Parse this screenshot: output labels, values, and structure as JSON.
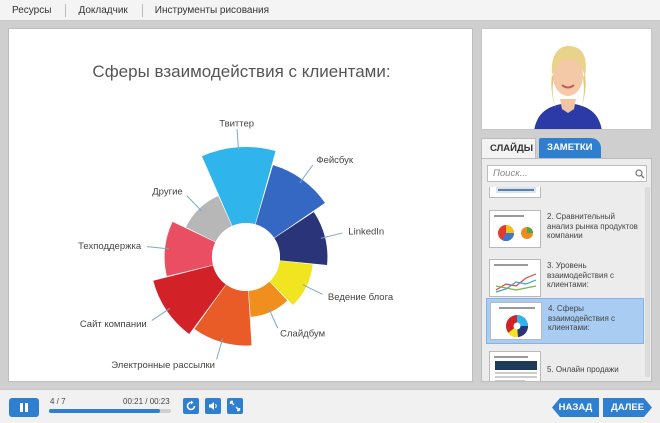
{
  "topbar": {
    "items": [
      "Ресурсы",
      "Докладчик",
      "Инструменты рисования"
    ]
  },
  "slide": {
    "title": "Сферы взаимодействия с клиентами:"
  },
  "chart_data": {
    "type": "pie",
    "title": "Сферы взаимодействия с клиентами:",
    "categories": [
      "Твиттер",
      "Фейсбук",
      "LinkedIn",
      "Ведение блога",
      "Слайдбум",
      "Электронные рассылки",
      "Сайт компании",
      "Техподдержка",
      "Другие"
    ],
    "values": [
      10,
      8,
      6,
      4,
      3,
      7,
      8,
      6,
      4
    ],
    "colors": [
      "#2fb5ec",
      "#3568c2",
      "#2a3478",
      "#f1e420",
      "#f18f1e",
      "#e95b27",
      "#d32128",
      "#ea4e63",
      "#b7b7b7"
    ]
  },
  "sidebar": {
    "tab_slides": "СЛАЙДЫ",
    "tab_notes": "ЗАМЕТКИ",
    "search_placeholder": "Поиск...",
    "items": [
      {
        "label": ""
      },
      {
        "label": "2. Сравнительный анализ рынка продуктов компании"
      },
      {
        "label": "3. Уровень взаимодействия с клиентами:"
      },
      {
        "label": "4. Сферы взаимодействия с клиентами:"
      },
      {
        "label": "5. Онлайн продажи"
      }
    ],
    "active_index": 3
  },
  "player": {
    "counter": "4 / 7",
    "time": "00:21 / 00:23",
    "progress": 0.91,
    "prev_label": "НАЗАД",
    "next_label": "ДАЛЕЕ"
  }
}
